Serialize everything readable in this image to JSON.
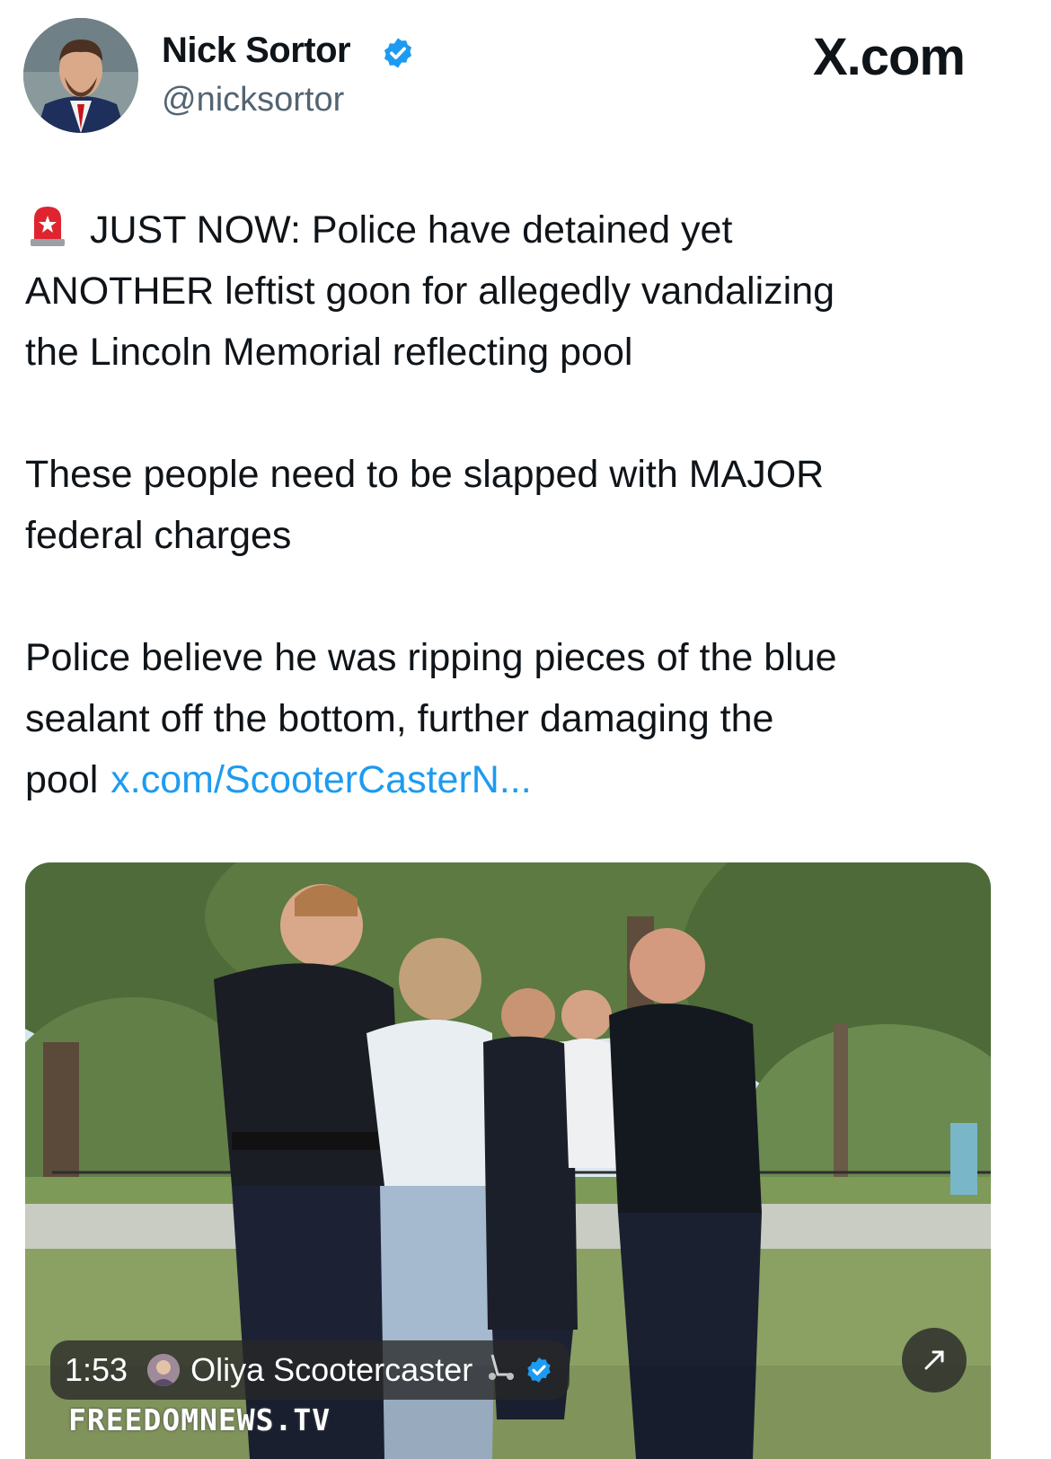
{
  "header": {
    "name": "Nick Sortor",
    "handle": "@nicksortor",
    "site_logo": "X.com",
    "avatar_icon": "user-avatar",
    "verified_icon": "verified-badge-icon"
  },
  "tweet": {
    "siren_icon": "police-siren-emoji",
    "line1": "JUST NOW: Police have detained yet",
    "line2": "ANOTHER leftist goon for allegedly vandalizing",
    "line3": "the Lincoln Memorial reflecting pool",
    "para2_line1": "These people need to be slapped with MAJOR",
    "para2_line2": "federal charges",
    "para3_line1": "Police believe he was ripping pieces of the blue",
    "para3_line2": "sealant off the bottom, further damaging the",
    "para3_line3": "pool",
    "link": "x.com/ScooterCasterN..."
  },
  "media": {
    "type": "video",
    "duration": "1:53",
    "source_name": "Oliya Scootercaster",
    "scooter_icon": "scooter-emoji",
    "watermark": "FREEDOMNEWS.TV",
    "expand_icon": "expand-icon"
  },
  "colors": {
    "link": "#1d9bf0",
    "verified": "#1d9bf0",
    "handle": "#536471",
    "text": "#0f1419"
  }
}
